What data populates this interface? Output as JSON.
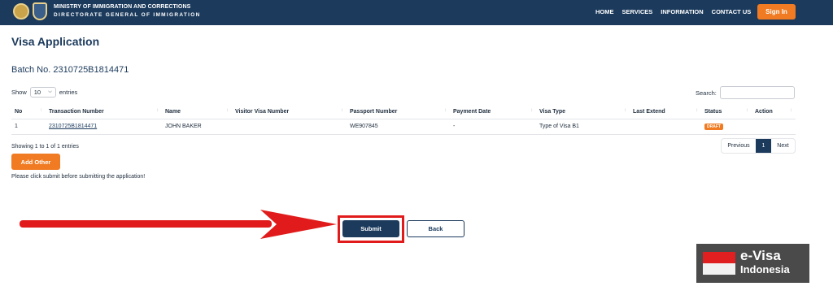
{
  "header": {
    "org_title": "MINISTRY OF IMMIGRATION AND CORRECTIONS",
    "org_subtitle": "DIRECTORATE GENERAL OF IMMIGRATION",
    "nav": [
      "HOME",
      "SERVICES",
      "INFORMATION",
      "CONTACT US"
    ],
    "signin_label": "Sign In"
  },
  "page": {
    "title": "Visa Application",
    "batch": "Batch No. 2310725B1814471"
  },
  "table_controls": {
    "show_label": "Show",
    "page_length": "10",
    "entries_label": "entries",
    "search_label": "Search:",
    "search_value": ""
  },
  "table": {
    "columns": [
      "No",
      "Transaction Number",
      "Name",
      "Visitor Visa Number",
      "Passport Number",
      "Payment Date",
      "Visa Type",
      "Last Extend",
      "Status",
      "Action"
    ],
    "rows": [
      {
        "no": "1",
        "transaction_number": "2310725B1814471",
        "name": "JOHN BAKER",
        "visitor_visa_number": "",
        "passport_number": "WE907845",
        "payment_date": "-",
        "visa_type": "Type of Visa B1",
        "last_extend": "",
        "status": "DRAFT",
        "action": ""
      }
    ]
  },
  "pagination": {
    "info": "Showing 1 to 1 of 1 entries",
    "previous": "Previous",
    "current": "1",
    "next": "Next"
  },
  "actions": {
    "add_other": "Add Other",
    "note": "Please click submit before submitting the application!",
    "submit": "Submit",
    "back": "Back"
  },
  "watermark": {
    "line1": "e-Visa",
    "line2": "Indonesia"
  },
  "colors": {
    "header_bg": "#1b3a5c",
    "accent": "#f07b22",
    "highlight": "#e11b1b"
  }
}
